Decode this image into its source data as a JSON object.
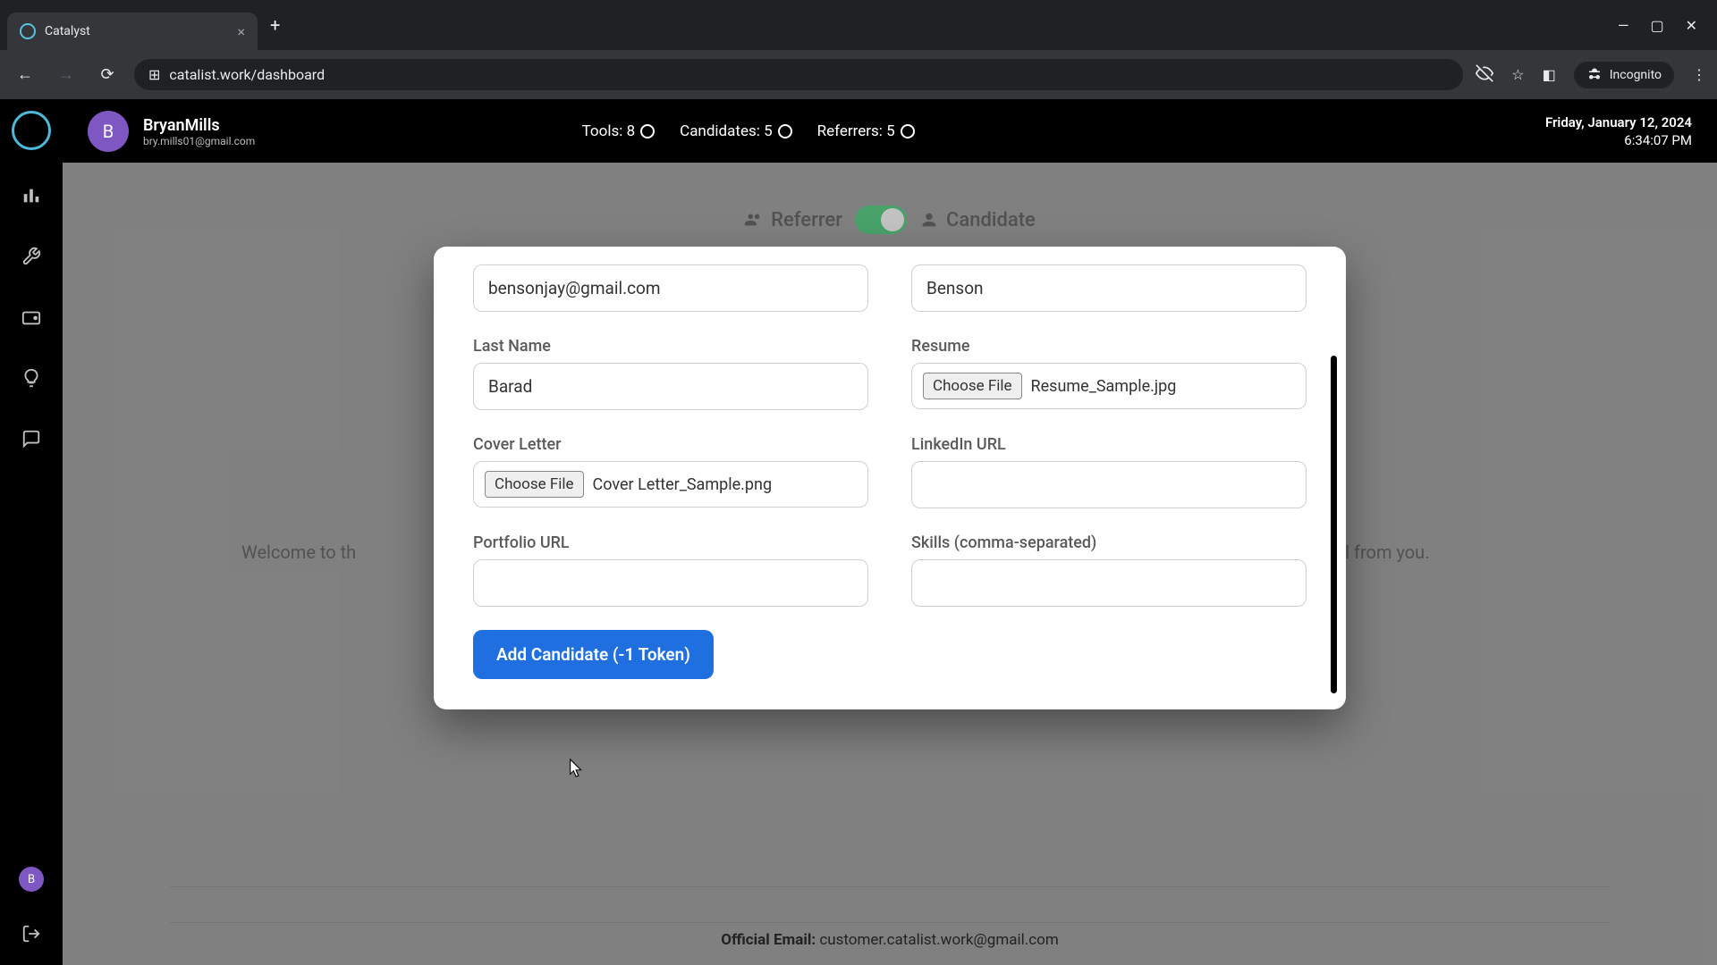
{
  "browser": {
    "tab_title": "Catalyst",
    "url": "catalist.work/dashboard",
    "incognito_label": "Incognito"
  },
  "header": {
    "user_name": "BryanMills",
    "user_email": "bry.mills01@gmail.com",
    "avatar_letter": "B",
    "stats": {
      "tools_label": "Tools: 8",
      "candidates_label": "Candidates: 5",
      "referrers_label": "Referrers: 5"
    },
    "date": "Friday, January 12, 2024",
    "time": "6:34:07 PM"
  },
  "toggle": {
    "left": "Referrer",
    "right": "Candidate"
  },
  "back_text": "Welcome to th                                                                                                                                                                                                     ested a referral from you.",
  "form": {
    "email_value": "bensonjay@gmail.com",
    "first_name_value": "Benson",
    "last_name_label": "Last Name",
    "last_name_value": "Barad",
    "resume_label": "Resume",
    "resume_file": "Resume_Sample.jpg",
    "cover_label": "Cover Letter",
    "cover_file": "Cover Letter_Sample.png",
    "linkedin_label": "LinkedIn URL",
    "linkedin_value": "",
    "portfolio_label": "Portfolio URL",
    "portfolio_value": "",
    "skills_label": "Skills (comma-separated)",
    "skills_value": "",
    "choose_file_label": "Choose File",
    "submit_label": "Add Candidate (-1 Token)"
  },
  "footer": {
    "prefix": "Official Email:",
    "email": "customer.catalist.work@gmail.com"
  }
}
